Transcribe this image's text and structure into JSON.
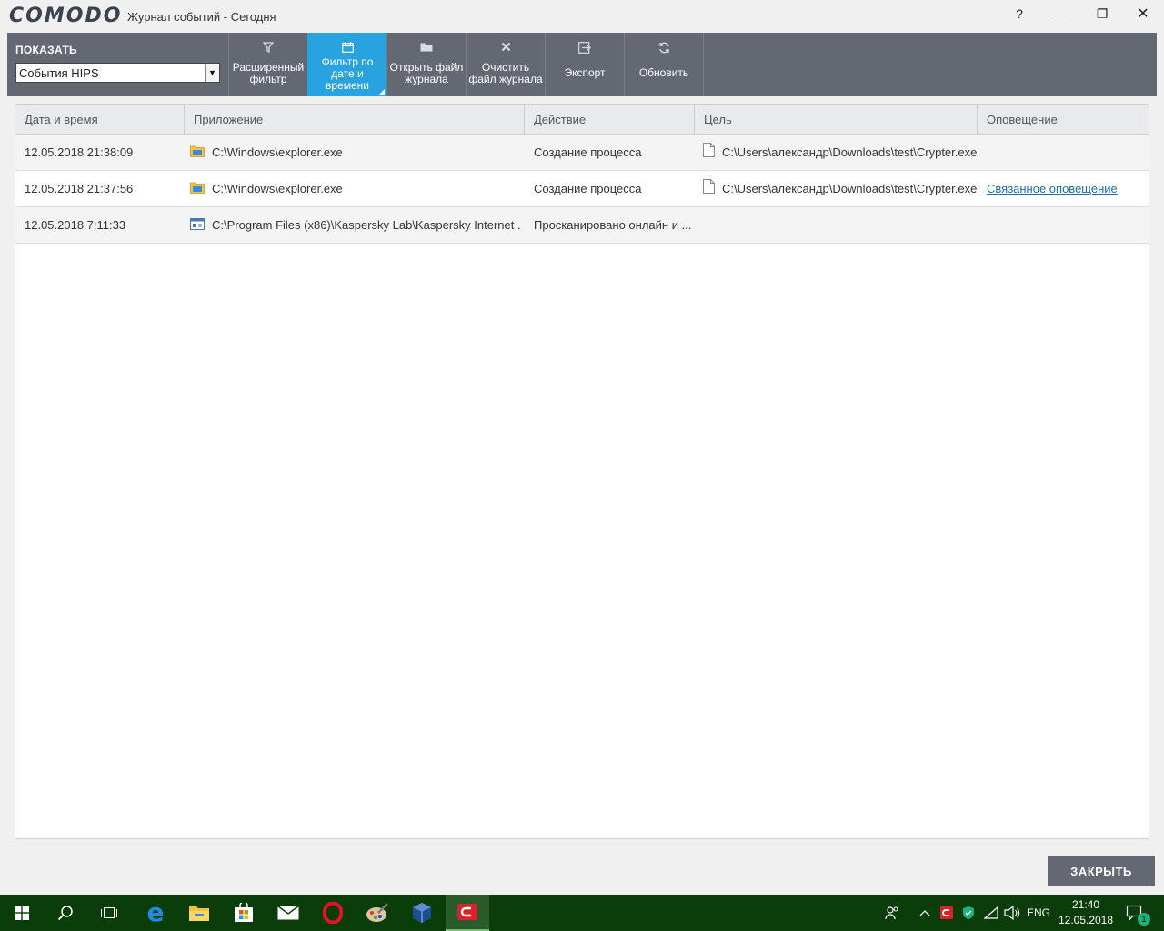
{
  "app": {
    "logo": "COMODO",
    "title": "Журнал событий - Сегодня",
    "help": "?",
    "minimize": "—",
    "restore": "❐",
    "close": "✕"
  },
  "toolbar": {
    "show_label": "ПОКАЗАТЬ",
    "select_value": "События HIPS",
    "buttons": [
      {
        "label": "Расширенный\nфильтр",
        "icon": "filter-icon"
      },
      {
        "label": "Фильтр по\nдате и\nвремени",
        "icon": "calendar-icon",
        "active": true
      },
      {
        "label": "Открыть файл\nжурнала",
        "icon": "folder-icon"
      },
      {
        "label": "Очистить\nфайл журнала",
        "icon": "clear-icon"
      },
      {
        "label": "Экспорт",
        "icon": "export-icon"
      },
      {
        "label": "Обновить",
        "icon": "refresh-icon"
      }
    ]
  },
  "table": {
    "columns": [
      "Дата и время",
      "Приложение",
      "Действие",
      "Цель",
      "Оповещение"
    ],
    "rows": [
      {
        "datetime": "12.05.2018 21:38:09",
        "app": "C:\\Windows\\explorer.exe",
        "app_icon": "explorer-icon",
        "action": "Создание процесса",
        "target": "C:\\Users\\александр\\Downloads\\test\\Crypter.exe",
        "alert": ""
      },
      {
        "datetime": "12.05.2018 21:37:56",
        "app": "C:\\Windows\\explorer.exe",
        "app_icon": "explorer-icon",
        "action": "Создание процесса",
        "target": "C:\\Users\\александр\\Downloads\\test\\Crypter.exe",
        "alert": "Связанное оповещение"
      },
      {
        "datetime": "12.05.2018 7:11:33",
        "app": "C:\\Program Files (x86)\\Kaspersky Lab\\Kaspersky Internet ...",
        "app_icon": "app-window-icon",
        "action": "Просканировано онлайн и ...",
        "target": "",
        "alert": ""
      }
    ]
  },
  "footer": {
    "close_label": "ЗАКРЫТЬ"
  },
  "taskbar": {
    "items": [
      "windows-start-icon",
      "search-icon",
      "task-view-icon",
      "edge-icon",
      "file-explorer-icon",
      "store-icon",
      "mail-icon",
      "opera-icon",
      "paint-icon",
      "virtualbox-icon",
      "comodo-icon"
    ],
    "tray": {
      "language": "ENG",
      "time": "21:40",
      "date": "12.05.2018",
      "notifications": "1"
    }
  },
  "colors": {
    "toolbar": "#636873",
    "active": "#29a3e0",
    "taskbar": "#0b3d0b",
    "link": "#1a6fb0"
  }
}
